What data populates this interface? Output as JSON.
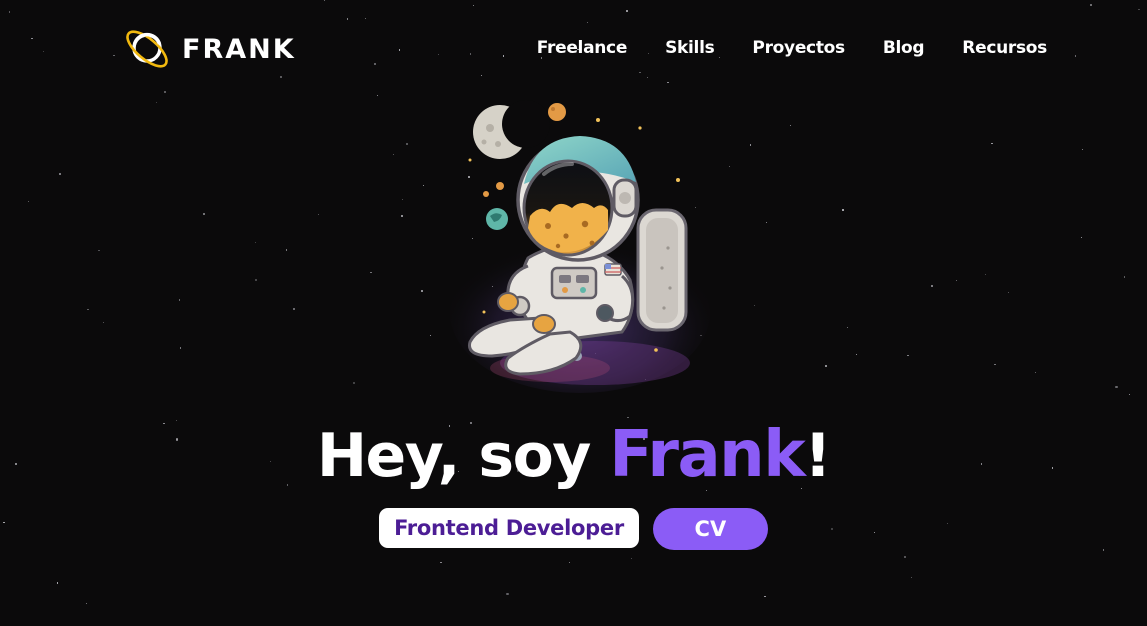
{
  "brand": {
    "name": "FRANK",
    "icon": "planet-icon",
    "ring_color": "#f2b90f"
  },
  "nav": {
    "items": [
      {
        "label": "Freelance"
      },
      {
        "label": "Skills"
      },
      {
        "label": "Proyectos"
      },
      {
        "label": "Blog"
      },
      {
        "label": "Recursos"
      }
    ]
  },
  "hero": {
    "illustration": "astronaut-illustration",
    "greeting": "Hey, soy ",
    "name": "Frank",
    "punctuation": "!",
    "role": "Frontend Developer",
    "cv_label": "CV"
  },
  "colors": {
    "background": "#0b0a0b",
    "accent": "#8b5cf6",
    "role_text": "#4c1d95",
    "text": "#ffffff"
  }
}
